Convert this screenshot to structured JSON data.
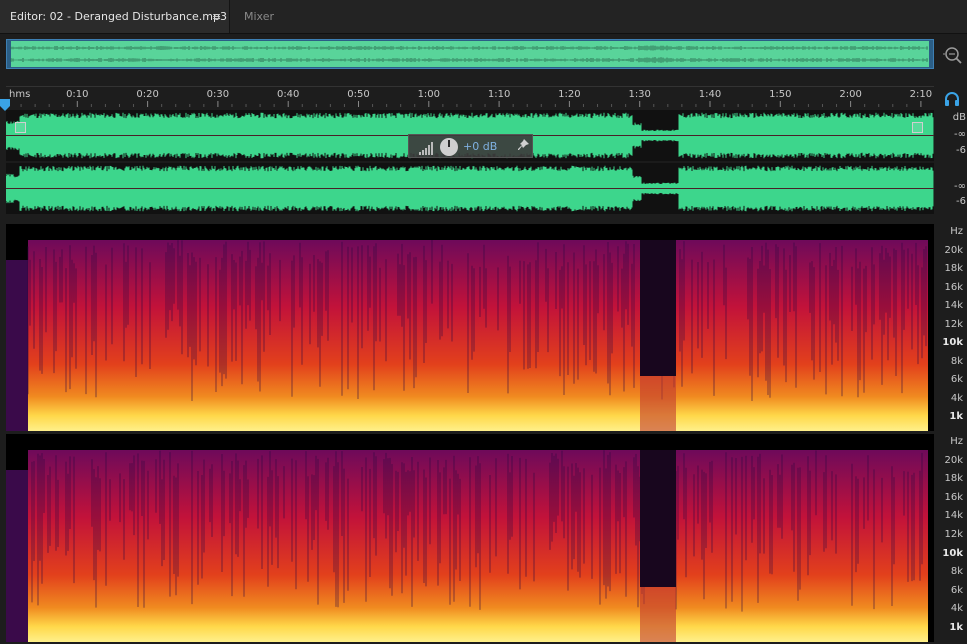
{
  "tabs": {
    "editor_label": "Editor: 02 - Deranged Disturbance.mp3",
    "menu_glyph": "≡",
    "mixer_label": "Mixer"
  },
  "icons": {
    "zoom": "zoom-icon",
    "headphones": "headphones-icon",
    "pin": "pin-icon"
  },
  "ruler": {
    "unit": "hms",
    "ticks": [
      "0:10",
      "0:20",
      "0:30",
      "0:40",
      "0:50",
      "1:00",
      "1:10",
      "1:20",
      "1:30",
      "1:40",
      "1:50",
      "2:00",
      "2:10"
    ]
  },
  "db_scale": {
    "channel1": [
      "dB",
      "-∞",
      "-6"
    ],
    "channel2": [
      "-∞",
      "-6"
    ]
  },
  "hud": {
    "volume": "+0 dB"
  },
  "hz_scale": {
    "spectrogram1": [
      "Hz",
      "20k",
      "18k",
      "16k",
      "14k",
      "12k",
      "10k",
      "8k",
      "6k",
      "4k",
      "1k"
    ],
    "spectrogram2": [
      "Hz",
      "20k",
      "18k",
      "16k",
      "14k",
      "12k",
      "10k",
      "8k",
      "6k",
      "4k",
      "1k"
    ]
  },
  "colors": {
    "waveform": "#3dd68c",
    "waveform_bg": "#111111",
    "overview_bg": "#2b5e86",
    "accent_blue": "#3aa3e6"
  }
}
